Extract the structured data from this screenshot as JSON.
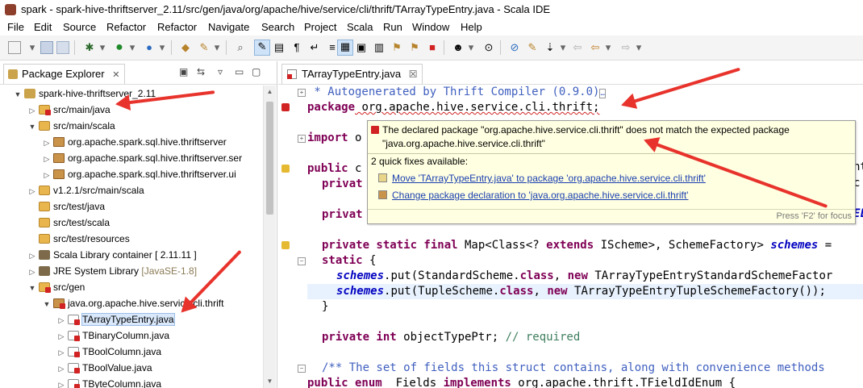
{
  "window": {
    "title": "spark - spark-hive-thriftserver_2.11/src/gen/java/org/apache/hive/service/cli/thrift/TArrayTypeEntry.java - Scala IDE"
  },
  "menu": [
    "File",
    "Edit",
    "Source",
    "Refactor",
    "Refactor",
    "Navigate",
    "Search",
    "Project",
    "Scala",
    "Run",
    "Window",
    "Help"
  ],
  "package_explorer": {
    "tab_label": "Package Explorer",
    "tab_icon": "package-explorer-icon",
    "tree": [
      {
        "label": "spark-hive-thriftserver_2.11",
        "sub": "",
        "icon": "project-icon",
        "err": false
      },
      {
        "label": "src/main/java",
        "sub": "",
        "icon": "source-folder-icon",
        "err": true
      },
      {
        "label": "src/main/scala",
        "sub": "",
        "icon": "source-folder-icon",
        "err": false
      },
      {
        "label": "org.apache.spark.sql.hive.thriftserver",
        "sub": "",
        "icon": "package-icon",
        "err": false
      },
      {
        "label": "org.apache.spark.sql.hive.thriftserver.ser",
        "sub": "",
        "icon": "package-icon",
        "err": false
      },
      {
        "label": "org.apache.spark.sql.hive.thriftserver.ui",
        "sub": "",
        "icon": "package-icon",
        "err": false
      },
      {
        "label": "v1.2.1/src/main/scala",
        "sub": "",
        "icon": "source-folder-icon",
        "err": false
      },
      {
        "label": "src/test/java",
        "sub": "",
        "icon": "source-folder-icon",
        "err": false
      },
      {
        "label": "src/test/scala",
        "sub": "",
        "icon": "source-folder-icon",
        "err": false
      },
      {
        "label": "src/test/resources",
        "sub": "",
        "icon": "source-folder-icon",
        "err": false
      },
      {
        "label": "Scala Library container [ 2.11.11 ]",
        "sub": "",
        "icon": "library-icon",
        "err": false
      },
      {
        "label": "JRE System Library ",
        "sub": "[JavaSE-1.8]",
        "icon": "library-icon",
        "err": false
      },
      {
        "label": "src/gen",
        "sub": "",
        "icon": "source-folder-icon",
        "err": true
      },
      {
        "label": "java.org.apache.hive.service.cli.thrift",
        "sub": "",
        "icon": "package-icon",
        "err": true
      },
      {
        "label": "TArrayTypeEntry.java",
        "sub": "",
        "icon": "java-file-icon",
        "err": true
      },
      {
        "label": "TBinaryColumn.java",
        "sub": "",
        "icon": "java-file-icon",
        "err": true
      },
      {
        "label": "TBoolColumn.java",
        "sub": "",
        "icon": "java-file-icon",
        "err": true
      },
      {
        "label": "TBoolValue.java",
        "sub": "",
        "icon": "java-file-icon",
        "err": true
      },
      {
        "label": "TByteColumn.java",
        "sub": "",
        "icon": "java-file-icon",
        "err": true
      }
    ]
  },
  "editor": {
    "tab_label": "TArrayTypeEntry.java",
    "tab_close": "☒",
    "lines": {
      "l1": " * Autogenerated by Thrift Compiler (0.9.0)",
      "l2_kw": "package",
      "l2_rest": " org.apache.hive.service.cli.thrift;",
      "l3_kw": "import",
      "l3_rest": " o",
      "l4_kw": "public",
      "l4_rest": " c",
      "l4_right": "nt",
      "l5_kw": "privat",
      "l5_right": "c",
      "l6_kw": "privat",
      "l6_right": "EL",
      "l7_kw": "private static final",
      "l7_rest": " Map<Class<? ",
      "l7_kw2": "extends",
      "l7_rest2": " IScheme>, SchemeFactory> ",
      "l7_st": "schemes",
      "l7_end": " =",
      "l8_kw": "static",
      "l8_rest": " {",
      "l9_st": "schemes",
      "l9_rest": ".put(StandardScheme.",
      "l9_kw": "class",
      "l9_rest2": ", ",
      "l9_kw2": "new",
      "l9_rest3": " TArrayTypeEntryStandardSchemeFactor",
      "l10_st": "schemes",
      "l10_rest": ".put(TupleScheme.",
      "l10_kw": "class",
      "l10_rest2": ", ",
      "l10_kw2": "new",
      "l10_rest3": " TArrayTypeEntryTupleSchemeFactory());",
      "l11": "}",
      "l12_kw": "private int",
      "l12_rest": " objectTypePtr; ",
      "l12_cm": "// required",
      "l13": "/** The set of fields this struct contains, along with convenience methods",
      "l14_kw": "public enum",
      "l14_rest": " _Fields ",
      "l14_kw2": "implements",
      "l14_rest2": " org.apache.thrift.TFieldIdEnum {"
    }
  },
  "hover": {
    "message": "The declared package \"org.apache.hive.service.cli.thrift\" does not match the expected package \"java.org.apache.hive.service.cli.thrift\"",
    "quick_fixes_label": "2 quick fixes available:",
    "fix1": "Move 'TArrayTypeEntry.java' to package 'org.apache.hive.service.cli.thrift'",
    "fix2": "Change package declaration to 'java.org.apache.hive.service.cli.thrift'",
    "footer": "Press 'F2' for focus"
  },
  "colors": {
    "annotation_arrow": "#e8332c",
    "error_marker": "#d12323",
    "warning_marker": "#e6b933",
    "hover_bg": "#ffffe1"
  }
}
